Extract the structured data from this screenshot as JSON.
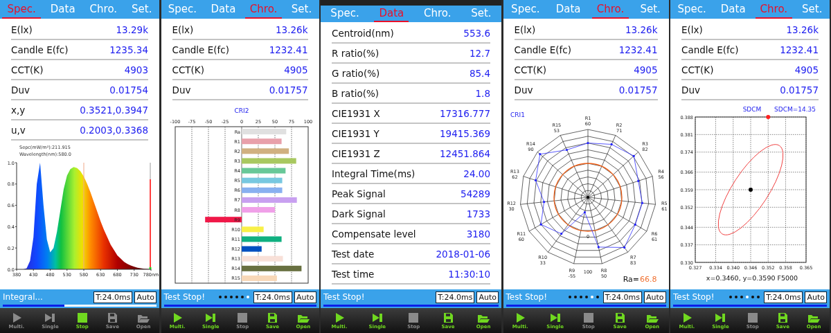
{
  "panels": [
    {
      "tabs": [
        {
          "label": "Spec.",
          "selected": true
        },
        {
          "label": "Data",
          "selected": false
        },
        {
          "label": "Chro.",
          "selected": false
        },
        {
          "label": "Set.",
          "selected": false
        }
      ],
      "readings": [
        {
          "label": "E(lx)",
          "value": "13.29k"
        },
        {
          "label": "Candle E(fc)",
          "value": "1235.34"
        },
        {
          "label": "CCT(K)",
          "value": "4903"
        },
        {
          "label": "Duv",
          "value": "0.01754"
        },
        {
          "label": "x,y",
          "value": "0.3521,0.3947"
        },
        {
          "label": "u,v",
          "value": "0.2003,0.3368"
        }
      ],
      "content": {
        "kind": "spectrum",
        "info": [
          "Sepc(mW/m²):211.915",
          "Wavelength(nm):580.0"
        ],
        "chart_data": {
          "type": "area",
          "xlim": [
            380,
            780
          ],
          "ylim": [
            0,
            1
          ],
          "x": [
            380,
            390,
            400,
            410,
            420,
            430,
            440,
            450,
            460,
            470,
            480,
            490,
            500,
            510,
            520,
            530,
            540,
            550,
            560,
            570,
            580,
            590,
            600,
            610,
            620,
            630,
            640,
            650,
            660,
            670,
            680,
            690,
            700,
            710,
            720,
            730,
            740,
            750,
            760,
            770,
            780
          ],
          "values": [
            0,
            0,
            0,
            0.01,
            0.08,
            0.3,
            0.8,
            1.0,
            0.6,
            0.28,
            0.16,
            0.2,
            0.35,
            0.55,
            0.75,
            0.88,
            0.94,
            0.96,
            0.95,
            0.92,
            0.87,
            0.8,
            0.72,
            0.63,
            0.54,
            0.45,
            0.37,
            0.3,
            0.23,
            0.18,
            0.13,
            0.1,
            0.07,
            0.05,
            0.035,
            0.025,
            0.015,
            0.01,
            0.005,
            0.003,
            0
          ],
          "xticks": [
            380,
            430,
            480,
            530,
            580,
            630,
            680,
            730,
            {
              "value": 780,
              "label": "780nm"
            }
          ],
          "yticks": [
            {
              "value": 0,
              "label": "0.0"
            },
            {
              "value": 0.2,
              "label": "0.2"
            },
            {
              "value": 0.4,
              "label": "0.4"
            },
            {
              "value": 0.6,
              "label": "0.6"
            },
            {
              "value": 0.8,
              "label": "0.8"
            },
            {
              "value": 1,
              "label": "1.0"
            }
          ],
          "ref_lines": [
            {
              "axis": "x",
              "value": 580
            },
            {
              "axis": "x",
              "value": 778
            }
          ]
        }
      },
      "status": {
        "text": "Integral...",
        "time": "T:24.0ms",
        "mode": "Auto",
        "level": 0.4
      },
      "toolbar": [
        {
          "kind": "multi",
          "label": "Multi.",
          "enabled": false
        },
        {
          "kind": "single",
          "label": "Single",
          "enabled": false
        },
        {
          "kind": "stop",
          "label": "Stop",
          "enabled": true
        },
        {
          "kind": "save",
          "label": "Save",
          "enabled": false
        },
        {
          "kind": "open",
          "label": "Open",
          "enabled": false
        }
      ]
    },
    {
      "tabs": [
        {
          "label": "Spec.",
          "selected": false
        },
        {
          "label": "Data",
          "selected": false
        },
        {
          "label": "Chro.",
          "selected": true
        },
        {
          "label": "Set.",
          "selected": false
        }
      ],
      "readings": [
        {
          "label": "E(lx)",
          "value": "13.26k"
        },
        {
          "label": "Candle E(fc)",
          "value": "1232.41"
        },
        {
          "label": "CCT(K)",
          "value": "4905"
        },
        {
          "label": "Duv",
          "value": "0.01757"
        }
      ],
      "content": {
        "kind": "cri_bars",
        "chart_data": {
          "type": "bar",
          "orientation": "horizontal",
          "grid": true,
          "title": "CRI2",
          "xlim": [
            -100,
            100
          ],
          "xticks": [
            -100,
            -75,
            -50,
            -25,
            0,
            25,
            50,
            75,
            100
          ],
          "categories": [
            "Ra",
            "R1",
            "R2",
            "R3",
            "R4",
            "R5",
            "R6",
            "R7",
            "R8",
            "R9",
            "R10",
            "R11",
            "R12",
            "R13",
            "R14",
            "R15"
          ],
          "values": [
            67,
            60,
            71,
            82,
            66,
            61,
            61,
            83,
            50,
            -55,
            33,
            60,
            30,
            62,
            90,
            53
          ]
        }
      },
      "status": {
        "text": "Test Stop!",
        "dots": [
          {
            "selected": false
          },
          {
            "selected": false
          },
          {
            "selected": false
          },
          {
            "selected": false
          },
          {
            "selected": false
          },
          {
            "selected": true
          }
        ],
        "time": "T:24.0ms",
        "mode": "Auto",
        "level": 1
      },
      "toolbar": [
        {
          "kind": "multi",
          "label": "Multi.",
          "enabled": true
        },
        {
          "kind": "single",
          "label": "Single",
          "enabled": true
        },
        {
          "kind": "stop",
          "label": "Stop",
          "enabled": false
        },
        {
          "kind": "save",
          "label": "Save",
          "enabled": true
        },
        {
          "kind": "open",
          "label": "Open",
          "enabled": true
        }
      ]
    },
    {
      "system_bar": true,
      "tabs": [
        {
          "label": "Spec.",
          "selected": false
        },
        {
          "label": "Data",
          "selected": true
        },
        {
          "label": "Chro.",
          "selected": false
        },
        {
          "label": "Set.",
          "selected": false
        }
      ],
      "readings": [
        {
          "label": "Centroid(nm)",
          "value": "553.6"
        },
        {
          "label": "R ratio(%)",
          "value": "12.7"
        },
        {
          "label": "G ratio(%)",
          "value": "85.4"
        },
        {
          "label": "B ratio(%)",
          "value": "1.8"
        },
        {
          "label": "CIE1931 X",
          "value": "17316.777"
        },
        {
          "label": "CIE1931 Y",
          "value": "19415.369"
        },
        {
          "label": "CIE1931 Z",
          "value": "12451.864"
        },
        {
          "label": "Integral Time(ms)",
          "value": "24.00"
        },
        {
          "label": "Peak Signal",
          "value": "54289"
        },
        {
          "label": "Dark Signal",
          "value": "1733"
        },
        {
          "label": "Compensate level",
          "value": "3180"
        },
        {
          "label": "Test date",
          "value": "2018-01-06"
        },
        {
          "label": "Test time",
          "value": "11:30:10"
        }
      ],
      "content": {
        "kind": "none"
      },
      "status": {
        "text": "Test Stop!",
        "time": "T:24.0ms",
        "mode": "Auto",
        "level": 1
      },
      "toolbar": [
        {
          "kind": "multi",
          "label": "Multi.",
          "enabled": true
        },
        {
          "kind": "single",
          "label": "Single",
          "enabled": true
        },
        {
          "kind": "stop",
          "label": "Stop",
          "enabled": false
        },
        {
          "kind": "save",
          "label": "Save",
          "enabled": true
        },
        {
          "kind": "open",
          "label": "Open",
          "enabled": true
        }
      ]
    },
    {
      "tabs": [
        {
          "label": "Spec.",
          "selected": false
        },
        {
          "label": "Data",
          "selected": false
        },
        {
          "label": "Chro.",
          "selected": true
        },
        {
          "label": "Set.",
          "selected": false
        }
      ],
      "readings": [
        {
          "label": "E(lx)",
          "value": "13.26k"
        },
        {
          "label": "Candle E(fc)",
          "value": "1232.41"
        },
        {
          "label": "CCT(K)",
          "value": "4905"
        },
        {
          "label": "Duv",
          "value": "0.01757"
        }
      ],
      "content": {
        "kind": "cri_radar",
        "title": "CRI1",
        "scale": [
          "0",
          "100"
        ],
        "ra_label": "Ra=",
        "ra_value": "66.8",
        "axes": [
          {
            "name": "R1",
            "value": "60"
          },
          {
            "name": "R2",
            "value": "71"
          },
          {
            "name": "R3",
            "value": "82"
          },
          {
            "name": "R4",
            "value": "56"
          },
          {
            "name": "R5",
            "value": "61"
          },
          {
            "name": "R6",
            "value": "61"
          },
          {
            "name": "R7",
            "value": "83"
          },
          {
            "name": "R8",
            "value": "50"
          },
          {
            "name": "R9",
            "value": "-55"
          },
          {
            "name": "R10",
            "value": "33"
          },
          {
            "name": "R11",
            "value": "60"
          },
          {
            "name": "R12",
            "value": "30"
          },
          {
            "name": "R13",
            "value": "62"
          },
          {
            "name": "R14",
            "value": "90"
          },
          {
            "name": "R15",
            "value": "53"
          }
        ]
      },
      "status": {
        "text": "Test Stop!",
        "dots": [
          {
            "selected": false
          },
          {
            "selected": false
          },
          {
            "selected": false
          },
          {
            "selected": false
          },
          {
            "selected": true
          },
          {
            "selected": false
          }
        ],
        "time": "T:24.0ms",
        "mode": "Auto",
        "level": 1
      },
      "toolbar": [
        {
          "kind": "multi",
          "label": "Multi.",
          "enabled": true
        },
        {
          "kind": "single",
          "label": "Single",
          "enabled": true
        },
        {
          "kind": "stop",
          "label": "Stop",
          "enabled": false
        },
        {
          "kind": "save",
          "label": "Save",
          "enabled": true
        },
        {
          "kind": "open",
          "label": "Open",
          "enabled": true
        }
      ]
    },
    {
      "tabs": [
        {
          "label": "Spec.",
          "selected": false
        },
        {
          "label": "Data",
          "selected": false
        },
        {
          "label": "Chro.",
          "selected": true
        },
        {
          "label": "Set.",
          "selected": false
        }
      ],
      "readings": [
        {
          "label": "E(lx)",
          "value": "13.26k"
        },
        {
          "label": "Candle E(fc)",
          "value": "1232.41"
        },
        {
          "label": "CCT(K)",
          "value": "4905"
        },
        {
          "label": "Duv",
          "value": "0.01757"
        }
      ],
      "content": {
        "kind": "sdcm",
        "title": "SDCM",
        "sdcm_value": "SDCM=14.35",
        "coordinates": "x=0.3460, y=0.3590 F5000",
        "chart_data": {
          "type": "scatter",
          "xlim": [
            0.327,
            0.365
          ],
          "ylim": [
            0.33,
            0.388
          ],
          "xticks": [
            {
              "value": 0.327,
              "label": "0.327"
            },
            {
              "value": 0.334,
              "label": "0.334"
            },
            {
              "value": 0.34,
              "label": "0.340"
            },
            {
              "value": 0.346,
              "label": "0.346"
            },
            {
              "value": 0.352,
              "label": "0.352"
            },
            {
              "value": 0.358,
              "label": "0.358"
            },
            {
              "value": 0.365,
              "label": "0.365"
            }
          ],
          "yticks": [
            {
              "value": 0.33,
              "label": "0.330"
            },
            {
              "value": 0.337,
              "label": "0.337"
            },
            {
              "value": 0.344,
              "label": "0.344"
            },
            {
              "value": 0.352,
              "label": "0.352"
            },
            {
              "value": 0.359,
              "label": "0.359"
            },
            {
              "value": 0.366,
              "label": "0.366"
            },
            {
              "value": 0.374,
              "label": "0.374"
            },
            {
              "value": 0.381,
              "label": "0.381"
            },
            {
              "value": 0.388,
              "label": "0.388"
            }
          ],
          "grid": true,
          "series": [
            {
              "color": "#000000",
              "x": [
                0.346
              ],
              "values": [
                0.359
              ]
            },
            {
              "color": "#ff2020",
              "x": [
                0.352
              ],
              "values": [
                0.388
              ]
            }
          ]
        }
      },
      "status": {
        "text": "Test Stop!",
        "dots": [
          {
            "selected": false
          },
          {
            "selected": false
          },
          {
            "selected": false
          },
          {
            "selected": true
          },
          {
            "selected": false
          },
          {
            "selected": false
          }
        ],
        "time": "T:24.0ms",
        "mode": "Auto",
        "level": 1
      },
      "toolbar": [
        {
          "kind": "multi",
          "label": "Multi.",
          "enabled": true
        },
        {
          "kind": "single",
          "label": "Single",
          "enabled": true
        },
        {
          "kind": "stop",
          "label": "Stop",
          "enabled": false
        },
        {
          "kind": "save",
          "label": "Save",
          "enabled": true
        },
        {
          "kind": "open",
          "label": "Open",
          "enabled": true
        }
      ]
    }
  ]
}
